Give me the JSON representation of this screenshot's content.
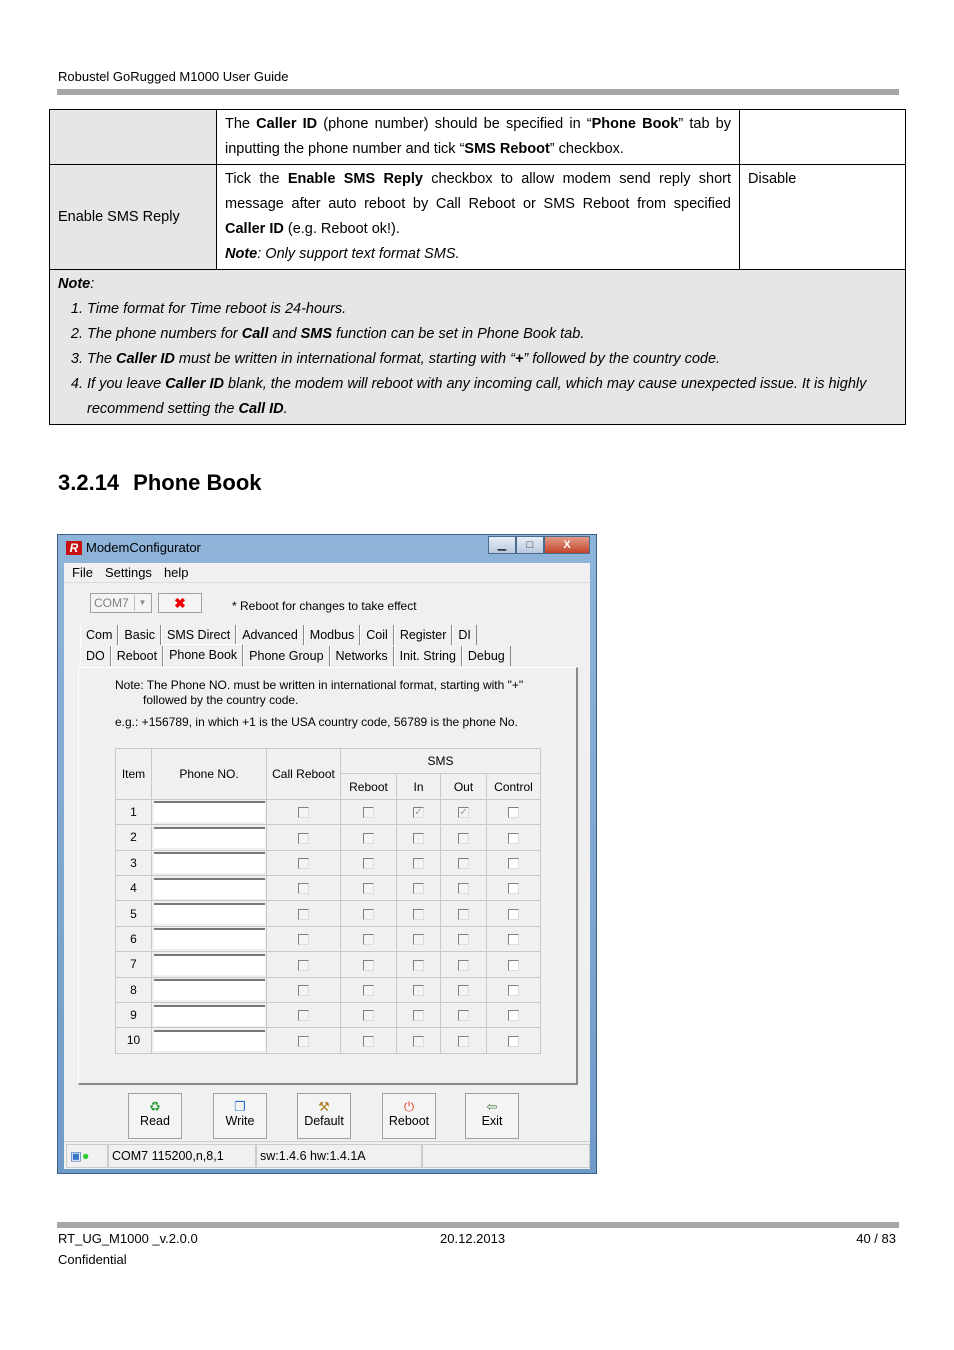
{
  "header": {
    "title": "Robustel GoRugged M1000 User Guide"
  },
  "doc_table": {
    "rows": [
      {
        "name": "",
        "desc_html": "The <b>Caller ID</b> (phone number) should be specified in “<b>Phone Book</b>” tab by inputting the phone number and tick “<b>SMS Reboot</b>” checkbox.",
        "default": ""
      },
      {
        "name": "Enable SMS Reply",
        "desc_html": "Tick the <b>Enable SMS Reply</b> checkbox to allow modem send reply short message after auto reboot by Call Reboot or SMS Reboot from specified <b>Caller ID</b> (e.g. Reboot ok!).<br><i><b>Note</b>: Only support text format SMS.</i>",
        "default": "Disable"
      }
    ],
    "note_title": "Note",
    "notes_html": [
      "Time format for Time reboot is 24-hours.",
      "The phone numbers for <b>Call</b> and <b>SMS</b> function can be set in Phone Book tab.",
      "The <b>Caller ID</b> must be written in international format, starting with “<b>+</b>” followed by the country code.",
      "If you leave <b>Caller ID</b> blank, the modem will reboot with any incoming call, which may cause unexpected issue. It is highly recommend setting the <b>Call ID</b>."
    ]
  },
  "section": {
    "number": "3.2.14",
    "title": "Phone Book"
  },
  "window": {
    "title": "ModemConfigurator",
    "logo": "R",
    "controls": {
      "minimize": "▁",
      "maximize": "□",
      "close": "X"
    },
    "menu": [
      "File",
      "Settings",
      "help"
    ],
    "com_port": "COM7",
    "disconnect_icon": "✖",
    "reboot_note": "* Reboot for changes to take effect",
    "tabs_row1": [
      "Com",
      "Basic",
      "SMS Direct",
      "Advanced",
      "Modbus",
      "Coil",
      "Register",
      "DI"
    ],
    "tabs_row2": [
      "DO",
      "Reboot",
      "Phone Book",
      "Phone Group",
      "Networks",
      "Init. String",
      "Debug"
    ],
    "active_tab": "Phone Book",
    "note_line1": "Note: The Phone NO. must be written in international format, starting with \"+\"",
    "note_line2": "followed by the country code.",
    "example": "e.g.: +156789, in which +1 is the USA country code, 56789 is the phone No.",
    "grid": {
      "headers": {
        "item": "Item",
        "phone": "Phone NO.",
        "call_reboot": "Call Reboot",
        "sms": "SMS",
        "reboot": "Reboot",
        "in": "In",
        "out": "Out",
        "control": "Control"
      },
      "rows": [
        {
          "item": "1",
          "phone": "",
          "call_reboot": false,
          "sms_reboot": false,
          "in": true,
          "out": true,
          "control": false
        },
        {
          "item": "2",
          "phone": "",
          "call_reboot": false,
          "sms_reboot": false,
          "in": false,
          "out": false,
          "control": false
        },
        {
          "item": "3",
          "phone": "",
          "call_reboot": false,
          "sms_reboot": false,
          "in": false,
          "out": false,
          "control": false
        },
        {
          "item": "4",
          "phone": "",
          "call_reboot": false,
          "sms_reboot": false,
          "in": false,
          "out": false,
          "control": false
        },
        {
          "item": "5",
          "phone": "",
          "call_reboot": false,
          "sms_reboot": false,
          "in": false,
          "out": false,
          "control": false
        },
        {
          "item": "6",
          "phone": "",
          "call_reboot": false,
          "sms_reboot": false,
          "in": false,
          "out": false,
          "control": false
        },
        {
          "item": "7",
          "phone": "",
          "call_reboot": false,
          "sms_reboot": false,
          "in": false,
          "out": false,
          "control": false
        },
        {
          "item": "8",
          "phone": "",
          "call_reboot": false,
          "sms_reboot": false,
          "in": false,
          "out": false,
          "control": false
        },
        {
          "item": "9",
          "phone": "",
          "call_reboot": false,
          "sms_reboot": false,
          "in": false,
          "out": false,
          "control": false
        },
        {
          "item": "10",
          "phone": "",
          "call_reboot": false,
          "sms_reboot": false,
          "in": false,
          "out": false,
          "control": false
        }
      ]
    },
    "buttons": [
      {
        "label": "Read",
        "icon": "♻",
        "color": "#2a9d3a"
      },
      {
        "label": "Write",
        "icon": "❐",
        "color": "#2a6fd0"
      },
      {
        "label": "Default",
        "icon": "⚒",
        "color": "#b07a20"
      },
      {
        "label": "Reboot",
        "icon": "⏻",
        "color": "#e0452a"
      },
      {
        "label": "Exit",
        "icon": "⇦",
        "color": "#3a7a3a"
      }
    ],
    "status": {
      "port": "COM7 115200,n,8,1",
      "version": "sw:1.4.6 hw:1.4.1A"
    }
  },
  "footer": {
    "doc_id": "RT_UG_M1000 _v.2.0.0",
    "date": "20.12.2013",
    "page": "40 / 83",
    "confidential": "Confidential"
  }
}
